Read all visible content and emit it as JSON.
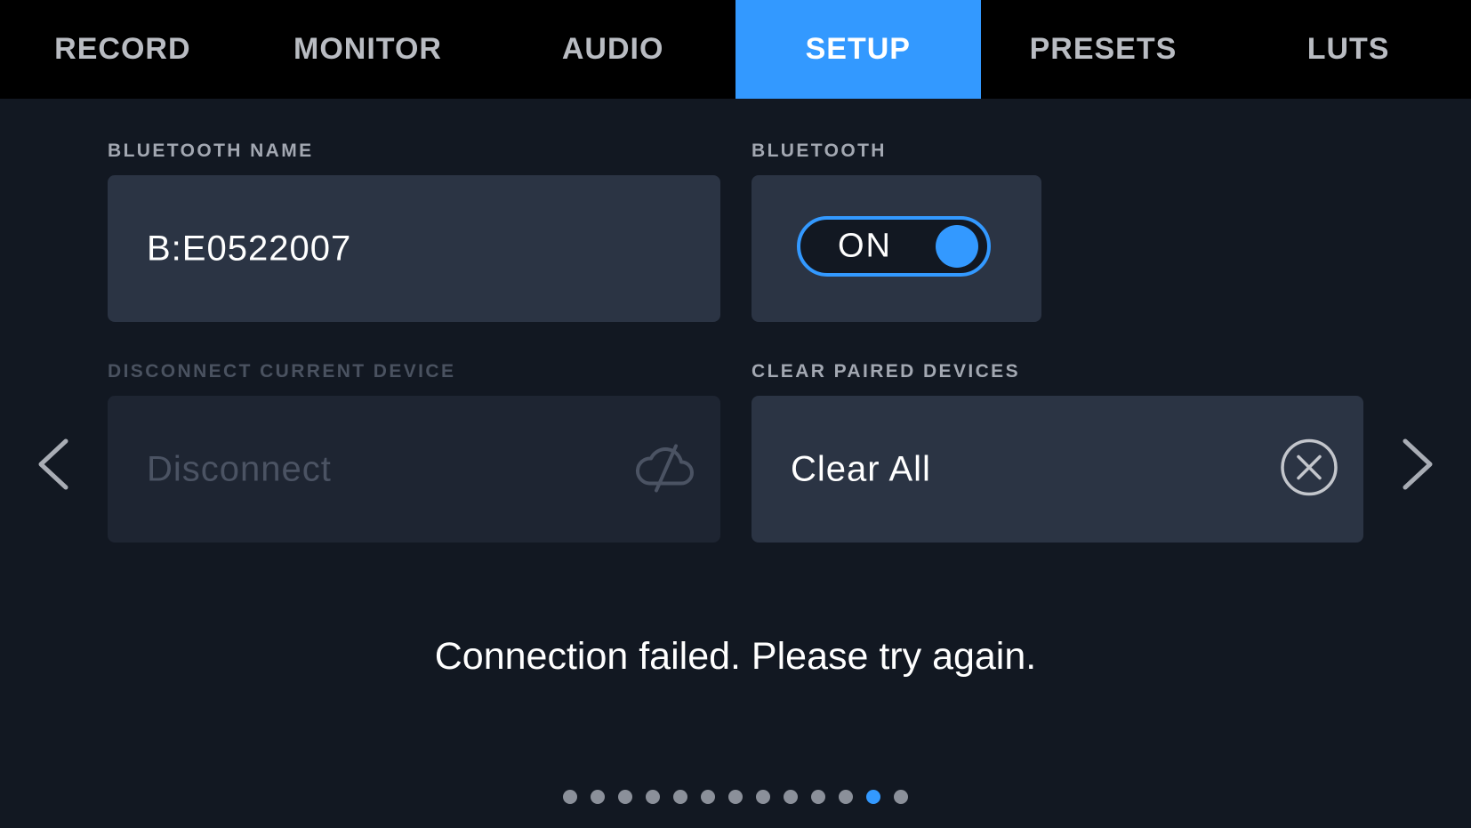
{
  "tabs": [
    {
      "label": "RECORD",
      "active": false
    },
    {
      "label": "MONITOR",
      "active": false
    },
    {
      "label": "AUDIO",
      "active": false
    },
    {
      "label": "SETUP",
      "active": true
    },
    {
      "label": "PRESETS",
      "active": false
    },
    {
      "label": "LUTS",
      "active": false
    }
  ],
  "bluetooth_name": {
    "label": "BLUETOOTH NAME",
    "value": "B:E0522007"
  },
  "bluetooth": {
    "label": "BLUETOOTH",
    "state": "ON"
  },
  "disconnect": {
    "label": "DISCONNECT CURRENT DEVICE",
    "button_label": "Disconnect",
    "enabled": false,
    "icon": "cloud-off-icon"
  },
  "clear_paired": {
    "label": "CLEAR PAIRED DEVICES",
    "button_label": "Clear All",
    "icon": "clear-circle-x-icon"
  },
  "message": "Connection failed. Please try again.",
  "pagination": {
    "total_pages": 13,
    "current_page": 12
  },
  "colors": {
    "accent": "#3399ff",
    "background": "#121822",
    "panel": "#2b3444",
    "tabbar": "#000000"
  }
}
